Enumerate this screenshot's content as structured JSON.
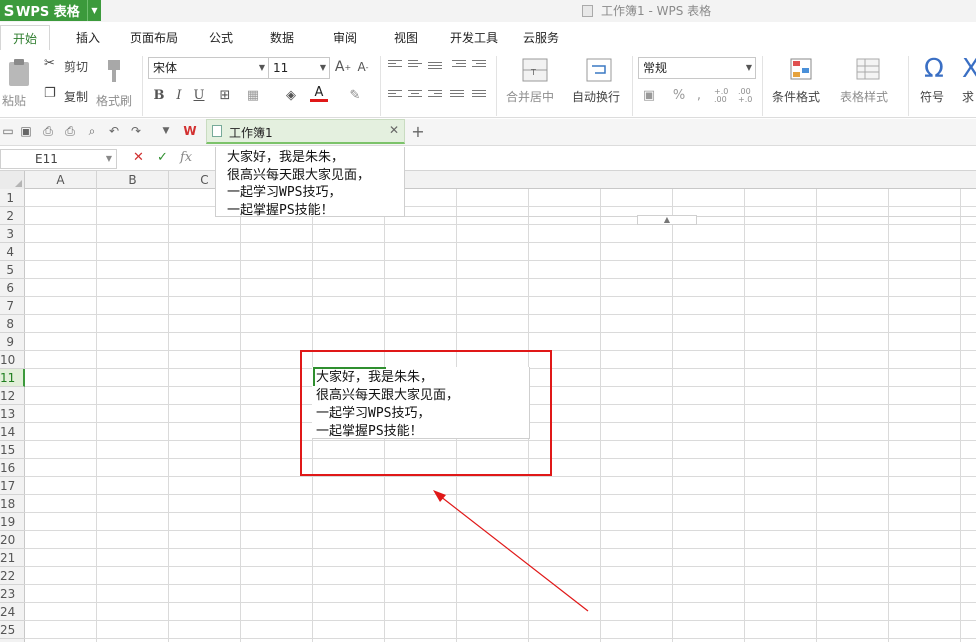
{
  "app": {
    "menu_label": "WPS 表格",
    "window_title": "工作簿1 - WPS 表格"
  },
  "tabs": [
    "开始",
    "插入",
    "页面布局",
    "公式",
    "数据",
    "审阅",
    "视图",
    "开发工具",
    "云服务"
  ],
  "ribbon": {
    "paste": "粘贴",
    "cut": "剪切",
    "copy": "复制",
    "format_painter": "格式刷",
    "font_name": "宋体",
    "font_size": "11",
    "increase_font": "A",
    "decrease_font": "A",
    "bold": "B",
    "italic": "I",
    "underline": "U",
    "font_color_letter": "A",
    "merge_center": "合并居中",
    "wrap_text": "自动换行",
    "number_format": "常规",
    "percent": "%",
    "thousands": ",",
    "inc_decimal": "+.0 .00",
    "dec_decimal": ".00 +.0",
    "conditional_format": "条件格式",
    "table_style": "表格样式",
    "symbol": "符号",
    "sum_partial": "求",
    "omega": "Ω"
  },
  "document_tab": {
    "name": "工作簿1"
  },
  "formula_bar": {
    "name_box": "E11",
    "fx": "fx",
    "content_lines": [
      "大家好，我是朱朱，",
      "很高兴每天跟大家见面，",
      "一起学习WPS技巧，",
      "一起掌握PS技能！"
    ]
  },
  "columns": [
    "A",
    "B",
    "C"
  ],
  "rows": [
    "1",
    "2",
    "3",
    "4",
    "5",
    "6",
    "7",
    "8",
    "9",
    "10",
    "11",
    "12",
    "13",
    "14",
    "15",
    "16",
    "17",
    "18",
    "19",
    "20",
    "21",
    "22",
    "23",
    "24",
    "25"
  ],
  "selected_row": "11",
  "cell_text_lines": [
    "大家好，我是朱朱，",
    "很高兴每天跟大家见面，",
    "一起学习WPS技巧，",
    "一起掌握PS技能！"
  ],
  "colors": {
    "accent_green": "#3c9a3c",
    "annotation_red": "#e01818"
  }
}
